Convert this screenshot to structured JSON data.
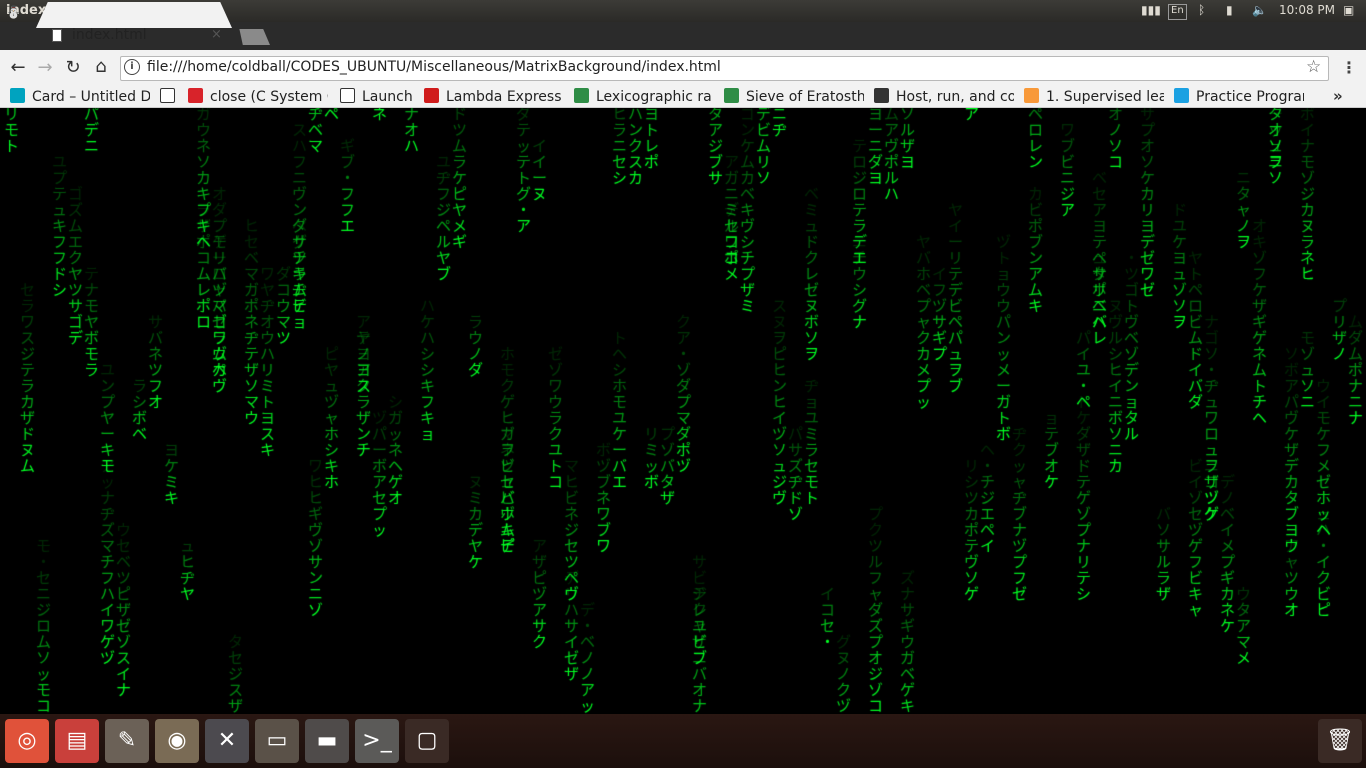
{
  "panel": {
    "window_title": "index.html - Google Chrome",
    "keyboard_layout": "En",
    "clock": "10:08 PM",
    "tray_icons": [
      "network-icon",
      "keyboard-icon",
      "bluetooth-icon",
      "battery-icon",
      "volume-icon",
      "session-icon"
    ]
  },
  "tab": {
    "title": "index.html",
    "close": "×"
  },
  "toolbar": {
    "back": "←",
    "forward": "→",
    "reload": "↻",
    "home": "⌂",
    "url": "file:///home/coldball/CODES_UBUNTU/Miscellaneous/MatrixBackground/index.html",
    "info": "i",
    "star": "☆",
    "menu": "⋮"
  },
  "bookmarks": [
    {
      "label": "Card – Untitled D",
      "color": "#00a3bf",
      "icon": "c-app-icon"
    },
    {
      "label": "",
      "color": "#ffffff",
      "icon": "page-icon"
    },
    {
      "label": "close (C System C",
      "color": "#d8232a",
      "icon": "spoj-icon"
    },
    {
      "label": "Launch",
      "color": "#ffffff",
      "icon": "page-icon"
    },
    {
      "label": "Lambda Express",
      "color": "#d01c1c",
      "icon": "oracle-icon"
    },
    {
      "label": "Lexicographic ra",
      "color": "#2f8d46",
      "icon": "geeksforgeeks-icon"
    },
    {
      "label": "Sieve of Eratosth",
      "color": "#2f8d46",
      "icon": "geeksforgeeks-icon"
    },
    {
      "label": "Host, run, and co",
      "color": "#333333",
      "icon": "host-icon"
    },
    {
      "label": "1. Supervised lea",
      "color": "#f89939",
      "icon": "sklearn-icon"
    },
    {
      "label": "Practice Program",
      "color": "#1ba1e2",
      "icon": "hackerrank-icon"
    }
  ],
  "bookmarks_more": "»",
  "matrix": {
    "color": "#00ff22",
    "glyphs": "アイウエオカキクケコサシスセソタチツテトナニヌネノハヒフヘホマミムメモヤユヨラリルレロワヲンガギグゲゴザジズゼゾダヂヅデドバビブベボパピプペポャュョッヴ・ー"
  },
  "launcher": [
    {
      "name": "ubuntu-dash-icon",
      "bg": "#e0523a",
      "glyph": "◎"
    },
    {
      "name": "file-cabinet-icon",
      "bg": "#c9403b",
      "glyph": "▤"
    },
    {
      "name": "text-editor-icon",
      "bg": "#6b6157",
      "glyph": "✎"
    },
    {
      "name": "chrome-icon",
      "bg": "#7a6b55",
      "glyph": "◉"
    },
    {
      "name": "system-settings-icon",
      "bg": "#4c4a4f",
      "glyph": "✕"
    },
    {
      "name": "files-folder-icon",
      "bg": "#5a5148",
      "glyph": "▭"
    },
    {
      "name": "drive-icon",
      "bg": "#4f4b4a",
      "glyph": "▬"
    },
    {
      "name": "terminal-icon",
      "bg": "#5b5a58",
      "glyph": ">_"
    },
    {
      "name": "workspace-switcher-icon",
      "bg": "#3a2a25",
      "glyph": "▢"
    },
    {
      "name": "trash-icon",
      "bg": "#3a2a25",
      "glyph": "🗑"
    }
  ]
}
